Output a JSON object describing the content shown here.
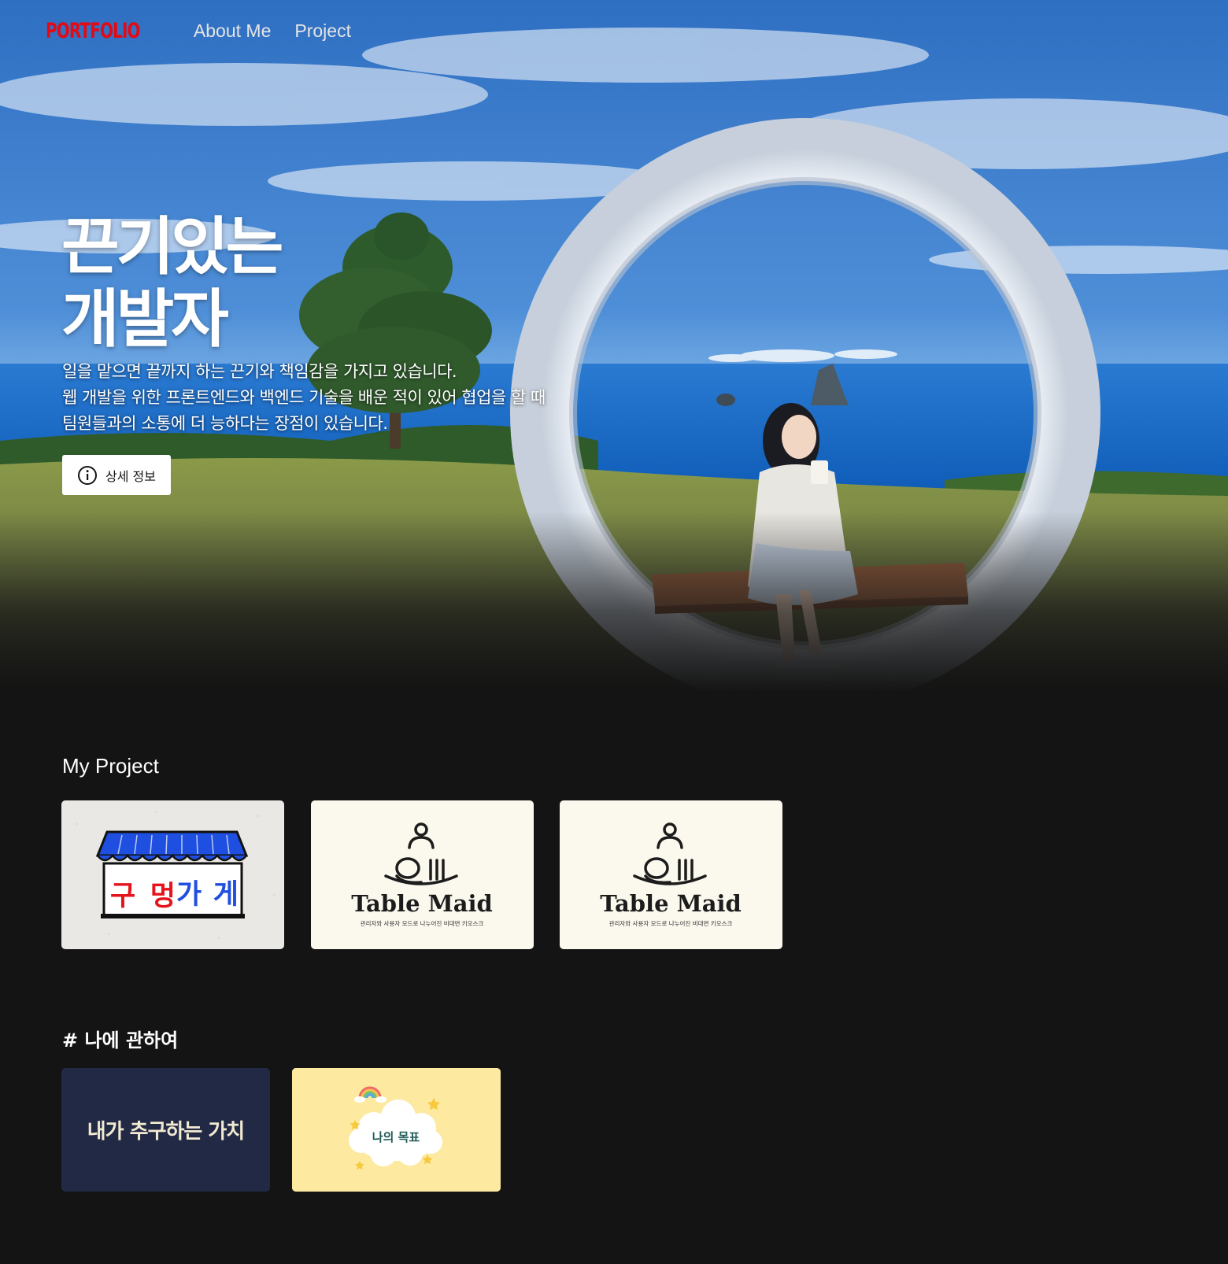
{
  "nav": {
    "logo": "PORTFOLIO",
    "links": [
      "About Me",
      "Project"
    ]
  },
  "hero": {
    "title_lines": [
      "끈기있는",
      "개발자"
    ],
    "description_lines": [
      "일을 맡으면 끝까지 하는 끈기와 책임감을 가지고 있습니다.",
      "웹 개발을 위한 프론트엔드와 백엔드 기술을 배운 적이 있어 협업을 할 때",
      "팀원들과의 소통에 더 능하다는 장점이 있습니다."
    ],
    "button_label": "상세 정보",
    "button_icon": "info-circle-icon"
  },
  "projects": {
    "heading": "My Project",
    "items": [
      {
        "logo_text": "구멍가게"
      },
      {
        "logo_title": "Table Maid",
        "logo_subtitle": "관리자와 사용자 모드로 나누어진 비대면 키오스크"
      },
      {
        "logo_title": "Table Maid",
        "logo_subtitle": "관리자와 사용자 모드로 나누어진 비대면 키오스크"
      }
    ]
  },
  "about": {
    "heading": "# 나에 관하여",
    "items": [
      {
        "label": "내가 추구하는 가치"
      },
      {
        "label": "나의 목표"
      }
    ]
  },
  "colors": {
    "background": "#141414",
    "logo_red": "#e50914",
    "card_navy": "#212945",
    "card_yellow": "#fde9a0",
    "tablemaid_bg": "#fbf8ee"
  }
}
